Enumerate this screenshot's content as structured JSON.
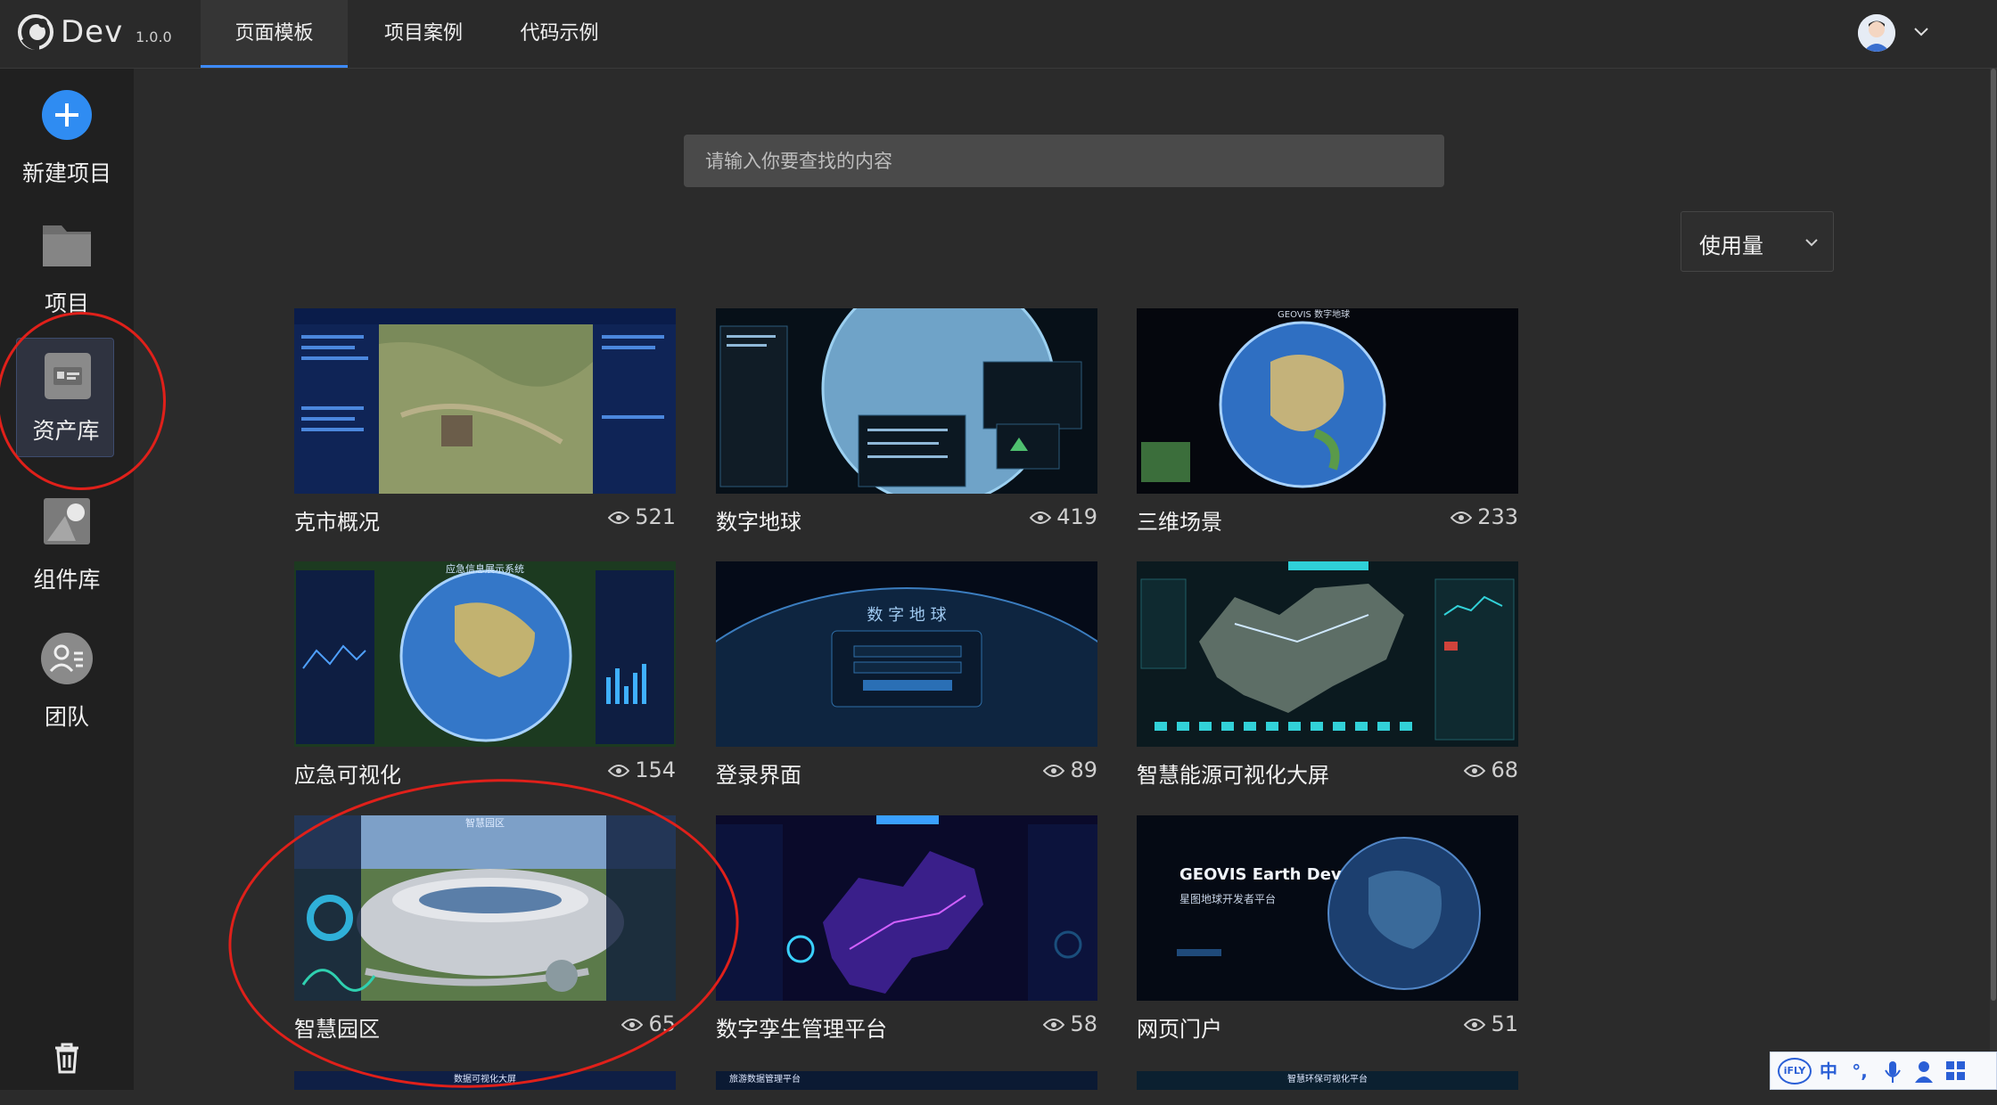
{
  "app": {
    "name": "Dev",
    "version": "1.0.0"
  },
  "nav_tabs": [
    {
      "label": "页面模板",
      "active": true
    },
    {
      "label": "项目案例",
      "active": false
    },
    {
      "label": "代码示例",
      "active": false
    }
  ],
  "sidebar": {
    "items": [
      {
        "label": "新建项目",
        "icon": "plus-circle-icon"
      },
      {
        "label": "项目",
        "icon": "folder-icon"
      },
      {
        "label": "资产库",
        "icon": "asset-library-icon",
        "active": true
      },
      {
        "label": "组件库",
        "icon": "component-icon"
      },
      {
        "label": "团队",
        "icon": "team-icon"
      }
    ],
    "bottom_icon": "trash-icon"
  },
  "search": {
    "placeholder": "请输入你要查找的内容"
  },
  "sort": {
    "label": "使用量"
  },
  "cards": [
    {
      "title": "克市概况",
      "views": "521"
    },
    {
      "title": "数字地球",
      "views": "419"
    },
    {
      "title": "三维场景",
      "views": "233"
    },
    {
      "title": "应急可视化",
      "views": "154"
    },
    {
      "title": "登录界面",
      "views": "89"
    },
    {
      "title": "智慧能源可视化大屏",
      "views": "68"
    },
    {
      "title": "智慧园区",
      "views": "65"
    },
    {
      "title": "数字孪生管理平台",
      "views": "58"
    },
    {
      "title": "网页门户",
      "views": "51"
    }
  ],
  "thumb_text": {
    "login": "数 字 地 球",
    "portal_title": "GEOVIS Earth Dev",
    "portal_sub": "星图地球开发者平台",
    "emergency": "应急信息展示系统",
    "park_title": "智慧园区",
    "earth3": "GEOVIS 数字地球"
  },
  "partial_cards": [
    {
      "title": "数据可视化大屏"
    },
    {
      "title": "旅游数据管理平台"
    },
    {
      "title": "智慧环保可视化平台"
    }
  ],
  "ime": {
    "items": [
      "iFLY",
      "中",
      "°,",
      "mic",
      "user",
      "grid"
    ]
  },
  "colors": {
    "accent": "#3d8bfd",
    "annotation": "#e0201a",
    "background": "#2b2b2b",
    "sidebar": "#202020"
  }
}
